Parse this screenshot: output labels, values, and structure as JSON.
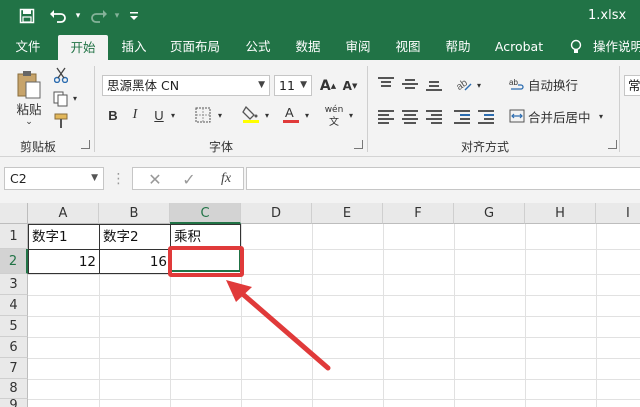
{
  "window": {
    "filename": "1.xlsx"
  },
  "quick_access": {
    "save_icon": "save-icon",
    "undo_icon": "undo-icon",
    "redo_icon": "redo-icon",
    "customize_icon": "customize-icon"
  },
  "tabs": [
    {
      "label": "文件",
      "active": false
    },
    {
      "label": "开始",
      "active": true
    },
    {
      "label": "插入",
      "active": false
    },
    {
      "label": "页面布局",
      "active": false
    },
    {
      "label": "公式",
      "active": false
    },
    {
      "label": "数据",
      "active": false
    },
    {
      "label": "审阅",
      "active": false
    },
    {
      "label": "视图",
      "active": false
    },
    {
      "label": "帮助",
      "active": false
    },
    {
      "label": "Acrobat",
      "active": false
    },
    {
      "label": "操作说明",
      "active": false
    }
  ],
  "ribbon": {
    "clipboard": {
      "paste_label": "粘贴",
      "group_label": "剪贴板"
    },
    "font": {
      "font_name": "思源黑体 CN",
      "font_size": "11",
      "bold": "B",
      "italic": "I",
      "underline": "U",
      "phonetic": "wén",
      "group_label": "字体"
    },
    "alignment": {
      "wrap_text": "自动换行",
      "merge_center": "合并后居中",
      "group_label": "对齐方式"
    },
    "number": {
      "format_partial": "常"
    }
  },
  "formula_bar": {
    "name_box": "C2",
    "fx_label": "fx",
    "formula": ""
  },
  "sheet": {
    "columns": [
      "A",
      "B",
      "C",
      "D",
      "E",
      "F",
      "G",
      "H",
      "I"
    ],
    "selected_column": "C",
    "rows": [
      "1",
      "2",
      "3",
      "4",
      "5",
      "6",
      "7",
      "8",
      "9"
    ],
    "selected_row": "2",
    "cells": {
      "A1": "数字1",
      "B1": "数字2",
      "C1": "乘积",
      "A2": "12",
      "B2": "16",
      "C2": ""
    }
  },
  "colors": {
    "brand": "#217346",
    "highlight": "#e03a3a"
  }
}
